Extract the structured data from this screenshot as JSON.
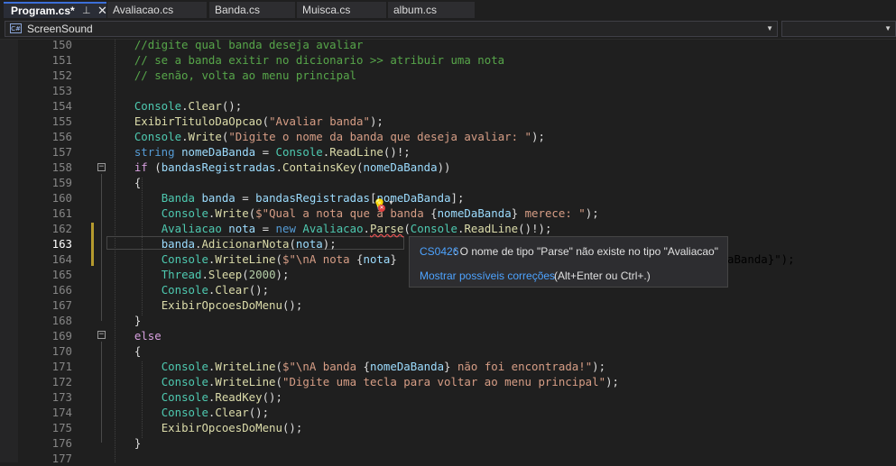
{
  "tabs": [
    {
      "label": "Program.cs*",
      "active": true
    },
    {
      "label": "Avaliacao.cs"
    },
    {
      "label": "Banda.cs"
    },
    {
      "label": "Muisca.cs"
    },
    {
      "label": "album.cs"
    }
  ],
  "tab_pin_glyph": "⊥",
  "tab_close_glyph": "✕",
  "navbar": {
    "project": "ScreenSound",
    "project_icon": "C#"
  },
  "lines": [
    {
      "n": "150"
    },
    {
      "n": "151"
    },
    {
      "n": "152"
    },
    {
      "n": "153"
    },
    {
      "n": "154"
    },
    {
      "n": "155"
    },
    {
      "n": "156"
    },
    {
      "n": "157"
    },
    {
      "n": "158"
    },
    {
      "n": "159"
    },
    {
      "n": "160"
    },
    {
      "n": "161"
    },
    {
      "n": "162"
    },
    {
      "n": "163"
    },
    {
      "n": "164"
    },
    {
      "n": "165"
    },
    {
      "n": "166"
    },
    {
      "n": "167"
    },
    {
      "n": "168"
    },
    {
      "n": "169"
    },
    {
      "n": "170"
    },
    {
      "n": "171"
    },
    {
      "n": "172"
    },
    {
      "n": "173"
    },
    {
      "n": "174"
    },
    {
      "n": "175"
    },
    {
      "n": "176"
    },
    {
      "n": "177"
    }
  ],
  "code": {
    "l150": "//digite qual banda deseja avaliar",
    "l151": "// se a banda exitir no dicionario >> atribuir uma nota",
    "l152": "// senão, volta ao menu principal",
    "console": "Console",
    "clear": "Clear",
    "exibirTitulo": "ExibirTituloDaOpcao",
    "avaliar_str": "\"Avaliar banda\"",
    "write": "Write",
    "digite_str": "\"Digite o nome da banda que deseja avaliar: \"",
    "string_kw": "string",
    "nomeDaBanda": "nomeDaBanda",
    "readLine": "ReadLine",
    "if_kw": "if",
    "bandasRegistradas": "bandasRegistradas",
    "containsKey": "ContainsKey",
    "banda_type": "Banda",
    "banda_var": "banda",
    "qual_str_a": "$\"Qual a nota que a banda ",
    "qual_str_b": " merece: \"",
    "avaliacao_type": "Avaliacao",
    "nota_var": "nota",
    "new_kw": "new",
    "parse": "Parse",
    "adicionarNota": "AdicionarNota",
    "writeLine": "WriteLine",
    "l164_str_a": "$\"\\nA nota ",
    "l164_tail": "aBanda}\");",
    "thread": "Thread",
    "sleep": "Sleep",
    "num2000": "2000",
    "exibirOpcoes": "ExibirOpcoesDoMenu",
    "else_kw": "else",
    "l171_str_a": "$\"\\nA banda ",
    "l171_str_b": " não foi encontrada!\"",
    "l172_str": "\"Digite uma tecla para voltar ao menu principal\"",
    "readKey": "ReadKey"
  },
  "tooltip": {
    "code": "CS0426",
    "message": ": O nome de tipo \"Parse\" não existe no tipo \"Avaliacao\"",
    "link": "Mostrar possíveis correções",
    "hint": "(Alt+Enter ou Ctrl+.)"
  },
  "icons": {
    "bulb": "lightbulb-error-icon",
    "fold": "collapse-icon"
  },
  "colors": {
    "comment": "#57a64a",
    "keyword": "#569cd6",
    "type": "#4ec9b0",
    "method": "#dcdcaa",
    "string": "#d69d85",
    "variable": "#9cdcfe",
    "link": "#4da3ff"
  }
}
